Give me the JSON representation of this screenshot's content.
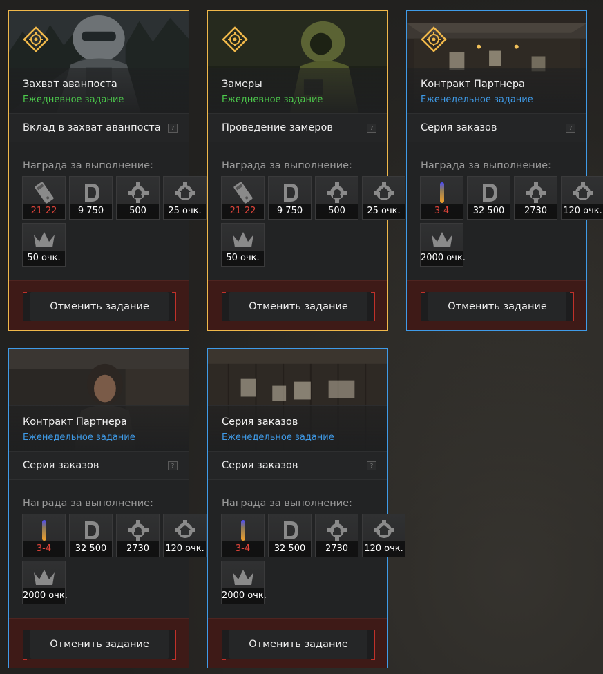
{
  "colors": {
    "daily_accent": "#f0b84a",
    "weekly_accent": "#3f9be8",
    "daily_text": "#4cc94c",
    "weekly_text": "#3f9be8",
    "red_value": "#e0443a",
    "footer_bg": "#3e1a17"
  },
  "common": {
    "reward_label": "Награда за выполнение:",
    "cancel_label": "Отменить задание",
    "help_label": "?"
  },
  "cards": [
    {
      "title": "Захват аванпоста",
      "subtitle": "Ежедневное задание",
      "task": "Вклад в захват аванпоста",
      "rewards": [
        {
          "icon": "magazine-icon",
          "value": "21-22"
        },
        {
          "icon": "currency-d-icon",
          "value": "9 750"
        },
        {
          "icon": "gear-icon",
          "value": "500"
        },
        {
          "icon": "gear-house-icon",
          "value": "25 очк."
        },
        {
          "icon": "crown-icon",
          "value": "50 очк."
        }
      ]
    },
    {
      "title": "Замеры",
      "subtitle": "Ежедневное задание",
      "task": "Проведение замеров",
      "rewards": [
        {
          "icon": "magazine-icon",
          "value": "21-22"
        },
        {
          "icon": "currency-d-icon",
          "value": "9 750"
        },
        {
          "icon": "gear-icon",
          "value": "500"
        },
        {
          "icon": "gear-house-icon",
          "value": "25 очк."
        },
        {
          "icon": "crown-icon",
          "value": "50 очк."
        }
      ]
    },
    {
      "title": "Контракт Партнера",
      "subtitle": "Еженедельное задание",
      "task": "Серия заказов",
      "rewards": [
        {
          "icon": "ammo-icon",
          "value": "3-4"
        },
        {
          "icon": "currency-d-icon",
          "value": "32 500"
        },
        {
          "icon": "gear-icon",
          "value": "2730"
        },
        {
          "icon": "gear-house-icon",
          "value": "120 очк."
        },
        {
          "icon": "crown-icon",
          "value": "2000 очк."
        }
      ]
    },
    {
      "title": "Контракт Партнера",
      "subtitle": "Еженедельное задание",
      "task": "Серия заказов",
      "rewards": [
        {
          "icon": "ammo-icon",
          "value": "3-4"
        },
        {
          "icon": "currency-d-icon",
          "value": "32 500"
        },
        {
          "icon": "gear-icon",
          "value": "2730"
        },
        {
          "icon": "gear-house-icon",
          "value": "120 очк."
        },
        {
          "icon": "crown-icon",
          "value": "2000 очк."
        }
      ]
    },
    {
      "title": "Серия заказов",
      "subtitle": "Еженедельное задание",
      "task": "Серия заказов",
      "rewards": [
        {
          "icon": "ammo-icon",
          "value": "3-4"
        },
        {
          "icon": "currency-d-icon",
          "value": "32 500"
        },
        {
          "icon": "gear-icon",
          "value": "2730"
        },
        {
          "icon": "gear-house-icon",
          "value": "120 очк."
        },
        {
          "icon": "crown-icon",
          "value": "2000 очк."
        }
      ]
    }
  ]
}
